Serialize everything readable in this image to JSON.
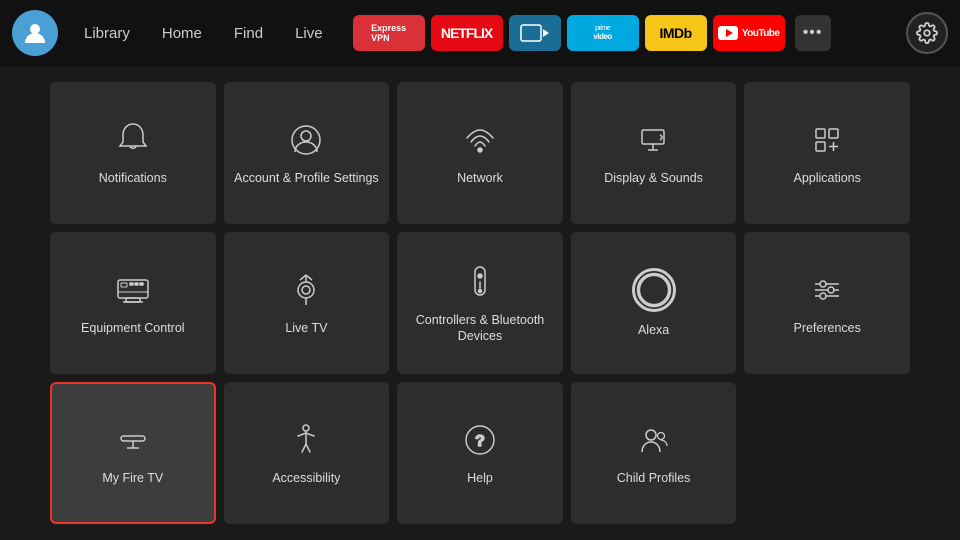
{
  "nav": {
    "links": [
      "Library",
      "Home",
      "Find",
      "Live"
    ],
    "apps": [
      {
        "name": "ExpressVPN",
        "label": "ExpressVPN",
        "class": "app-expressvpn"
      },
      {
        "name": "Netflix",
        "label": "NETFLIX",
        "class": "app-netflix"
      },
      {
        "name": "FreeVee",
        "label": "▶",
        "class": "app-freevee"
      },
      {
        "name": "PrimeVideo",
        "label": "prime video",
        "class": "app-primevideo"
      },
      {
        "name": "IMDb",
        "label": "IMDb",
        "class": "app-imdb"
      },
      {
        "name": "YouTube",
        "label": "▶ YouTube",
        "class": "app-youtube"
      }
    ],
    "moreLabel": "•••",
    "settingsLabel": "⚙"
  },
  "grid": {
    "items": [
      {
        "id": "notifications",
        "label": "Notifications",
        "icon": "bell"
      },
      {
        "id": "account-profile",
        "label": "Account & Profile Settings",
        "icon": "person-circle"
      },
      {
        "id": "network",
        "label": "Network",
        "icon": "wifi"
      },
      {
        "id": "display-sounds",
        "label": "Display & Sounds",
        "icon": "display-sound"
      },
      {
        "id": "applications",
        "label": "Applications",
        "icon": "apps-grid"
      },
      {
        "id": "equipment-control",
        "label": "Equipment Control",
        "icon": "tv-monitor"
      },
      {
        "id": "live-tv",
        "label": "Live TV",
        "icon": "antenna"
      },
      {
        "id": "controllers-bluetooth",
        "label": "Controllers & Bluetooth Devices",
        "icon": "remote"
      },
      {
        "id": "alexa",
        "label": "Alexa",
        "icon": "alexa"
      },
      {
        "id": "preferences",
        "label": "Preferences",
        "icon": "sliders"
      },
      {
        "id": "my-fire-tv",
        "label": "My Fire TV",
        "icon": "fire-tv",
        "selected": true
      },
      {
        "id": "accessibility",
        "label": "Accessibility",
        "icon": "accessibility"
      },
      {
        "id": "help",
        "label": "Help",
        "icon": "help-circle"
      },
      {
        "id": "child-profiles",
        "label": "Child Profiles",
        "icon": "child-profiles"
      }
    ]
  }
}
